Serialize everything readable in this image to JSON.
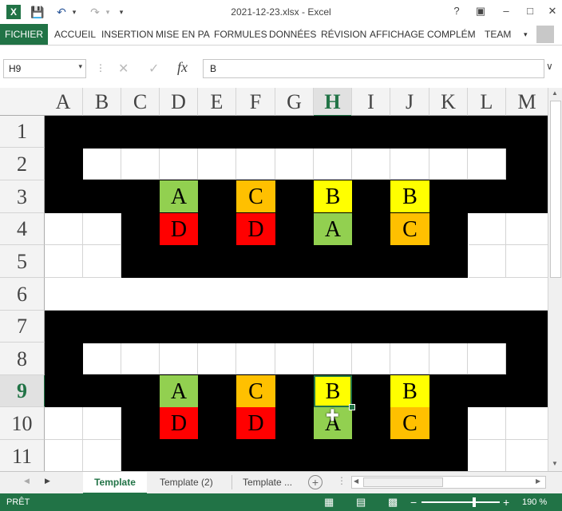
{
  "titlebar": {
    "title": "2021-12-23.xlsx - Excel",
    "help": "?",
    "minimize": "–",
    "restore": "□",
    "close": "✕",
    "app_icon": "excel-logo",
    "save_icon": "save-icon",
    "undo_icon": "undo-icon",
    "redo_icon": "redo-icon"
  },
  "ribbon": {
    "tabs": [
      "FICHIER",
      "ACCUEIL",
      "INSERTION",
      "MISE EN PA",
      "FORMULES",
      "DONNÉES",
      "RÉVISION",
      "AFFICHAGE",
      "COMPLÉM",
      "TEAM"
    ]
  },
  "formula_bar": {
    "name_box": "H9",
    "formula": "B",
    "fx_label": "fx",
    "cancel": "✕",
    "enter": "✓"
  },
  "columns": [
    "A",
    "B",
    "C",
    "D",
    "E",
    "F",
    "G",
    "H",
    "I",
    "J",
    "K",
    "L",
    "M"
  ],
  "rows": [
    "1",
    "2",
    "3",
    "4",
    "5",
    "6",
    "7",
    "8",
    "9",
    "10",
    "11"
  ],
  "selected": {
    "col": "H",
    "row": "9"
  },
  "grades": {
    "block1": {
      "row3": [
        "A",
        "C",
        "B",
        "B"
      ],
      "row4": [
        "D",
        "D",
        "A",
        "C"
      ]
    },
    "block2": {
      "row9": [
        "A",
        "C",
        "B",
        "B"
      ],
      "row10": [
        "D",
        "D",
        "A",
        "C"
      ]
    }
  },
  "grade_colors": {
    "A": "#92d050",
    "B": "#ffff00",
    "C": "#ffc000",
    "D": "#ff0000"
  },
  "sheet_tabs": [
    "Template",
    "Template (2)",
    "Template ..."
  ],
  "status": {
    "ready": "PRÊT",
    "zoom": "190 %"
  },
  "accent": "#217346"
}
